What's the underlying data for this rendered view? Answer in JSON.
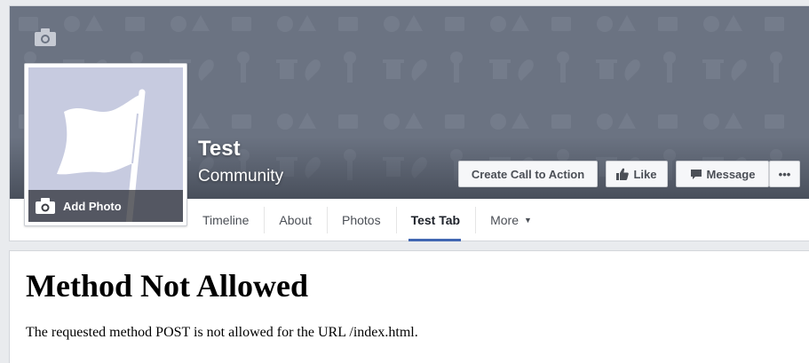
{
  "page": {
    "name": "Test",
    "category": "Community"
  },
  "cover": {
    "camera_icon": "camera-icon",
    "background_color": "#6b7382"
  },
  "profile": {
    "add_photo_label": "Add Photo",
    "placeholder_icon": "flag-icon",
    "placeholder_color": "#c7cbe0"
  },
  "actions": {
    "cta_label": "Create Call to Action",
    "like_label": "Like",
    "message_label": "Message",
    "more_label": "•••"
  },
  "tabs": [
    {
      "label": "Timeline"
    },
    {
      "label": "About"
    },
    {
      "label": "Photos"
    },
    {
      "label": "Test Tab",
      "active": true
    },
    {
      "label": "More",
      "caret": "▼"
    }
  ],
  "content": {
    "title": "Method Not Allowed",
    "message": "The requested method POST is not allowed for the URL /index.html."
  },
  "colors": {
    "accent": "#4267b2",
    "button_bg": "#f6f7f9"
  }
}
